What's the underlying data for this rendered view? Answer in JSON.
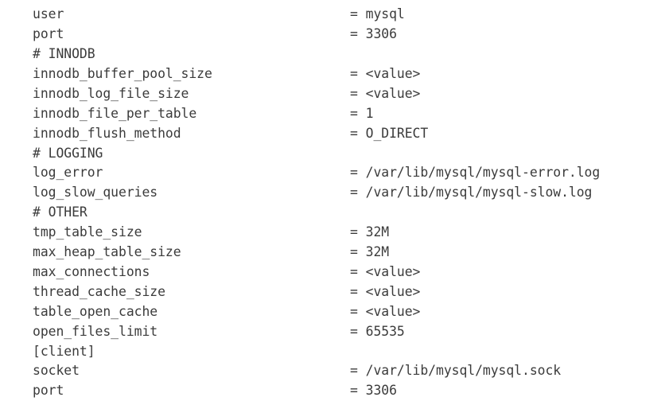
{
  "document": {
    "kind": "config-file-listing",
    "background_color": "#ffffff",
    "text_color": "#3b3b3b",
    "assignment_operator": "=",
    "lines": [
      {
        "type": "setting",
        "key": "user",
        "value": "= mysql"
      },
      {
        "type": "setting",
        "key": "port",
        "value": "= 3306"
      },
      {
        "type": "comment",
        "key": "# INNODB",
        "value": ""
      },
      {
        "type": "setting",
        "key": "innodb_buffer_pool_size",
        "value": "= <value>"
      },
      {
        "type": "setting",
        "key": "innodb_log_file_size",
        "value": "= <value>"
      },
      {
        "type": "setting",
        "key": "innodb_file_per_table",
        "value": "= 1"
      },
      {
        "type": "setting",
        "key": "innodb_flush_method",
        "value": "= O_DIRECT"
      },
      {
        "type": "comment",
        "key": "# LOGGING",
        "value": ""
      },
      {
        "type": "setting",
        "key": "log_error",
        "value": "= /var/lib/mysql/mysql-error.log"
      },
      {
        "type": "setting",
        "key": "log_slow_queries",
        "value": "= /var/lib/mysql/mysql-slow.log"
      },
      {
        "type": "comment",
        "key": "# OTHER",
        "value": ""
      },
      {
        "type": "setting",
        "key": "tmp_table_size",
        "value": "= 32M"
      },
      {
        "type": "setting",
        "key": "max_heap_table_size",
        "value": "= 32M"
      },
      {
        "type": "setting",
        "key": "max_connections",
        "value": "= <value>"
      },
      {
        "type": "setting",
        "key": "thread_cache_size",
        "value": "= <value>"
      },
      {
        "type": "setting",
        "key": "table_open_cache",
        "value": "= <value>"
      },
      {
        "type": "setting",
        "key": "open_files_limit",
        "value": "= 65535"
      },
      {
        "type": "section",
        "key": "[client]",
        "value": ""
      },
      {
        "type": "setting",
        "key": "socket",
        "value": "= /var/lib/mysql/mysql.sock"
      },
      {
        "type": "setting",
        "key": "port",
        "value": "= 3306"
      }
    ]
  }
}
